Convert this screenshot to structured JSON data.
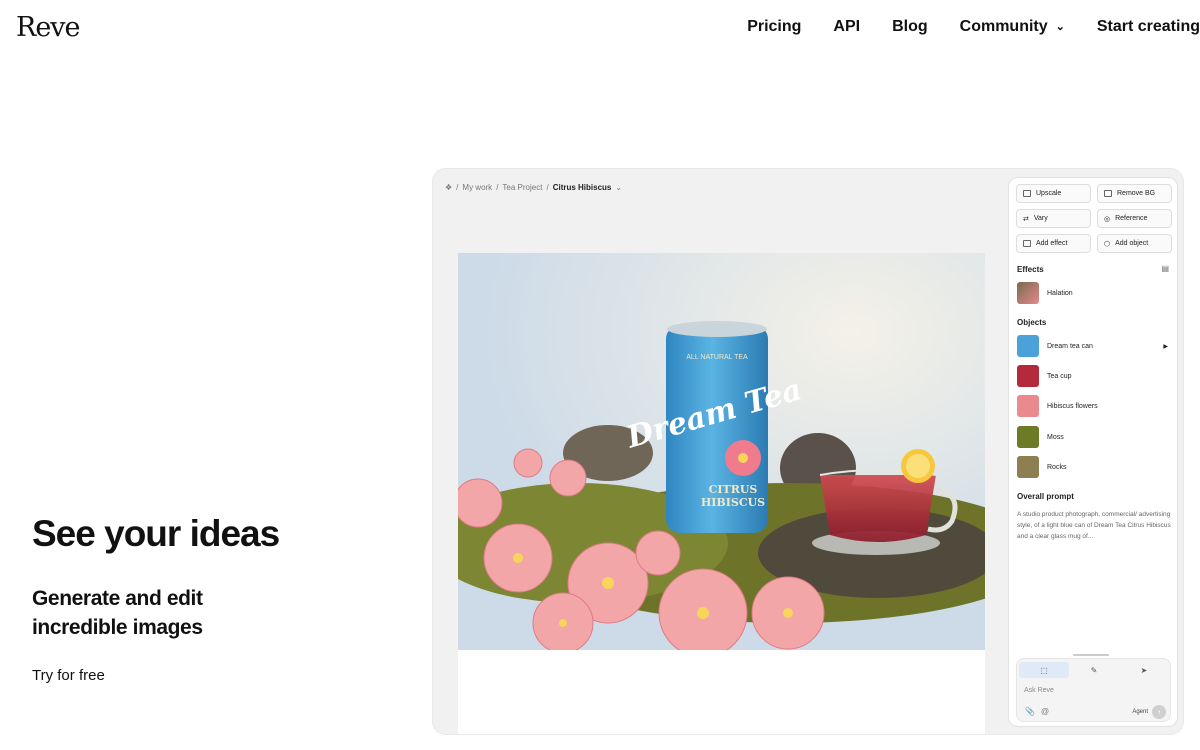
{
  "nav": {
    "logo": "Reve",
    "links": [
      "Pricing",
      "API",
      "Blog",
      "Community",
      "Start creating"
    ]
  },
  "hero": {
    "title": "See your ideas",
    "subtitle": "Generate and edit incredible images",
    "cta": "Try for free"
  },
  "app": {
    "breadcrumb": [
      "My work",
      "Tea Project",
      "Citrus Hibiscus"
    ],
    "tools": [
      "Upscale",
      "Remove BG",
      "Vary",
      "Reference",
      "Add effect",
      "Add object"
    ],
    "effects_title": "Effects",
    "effects": [
      "Halation"
    ],
    "objects_title": "Objects",
    "objects": [
      "Dream tea can",
      "Tea cup",
      "Hibiscus flowers",
      "Moss",
      "Rocks"
    ],
    "prompt_title": "Overall prompt",
    "prompt_text": "A studio product photograph, commercial/ advertising style, of a light blue can of Dream Tea Citrus Hibiscus and a clear glass mug of...",
    "ask_placeholder": "Ask Reve",
    "agent_label": "Agent",
    "can_top_text": "ALL NATURAL TEA",
    "can_brand": "Dream Tea",
    "can_flavor_1": "CITRUS",
    "can_flavor_2": "HIBISCUS"
  },
  "colors": {
    "can_blue": "#3f9fd4",
    "tea_red": "#b0283a",
    "flower_pink": "#f2a3a6",
    "moss_green": "#6f7a2a",
    "segment_active": "#dfe9f7"
  },
  "icons": [
    "chevron-down-icon",
    "home-icon",
    "paperclip-icon",
    "at-icon",
    "send-arrow-icon",
    "select-icon",
    "brush-icon",
    "cursor-icon"
  ]
}
